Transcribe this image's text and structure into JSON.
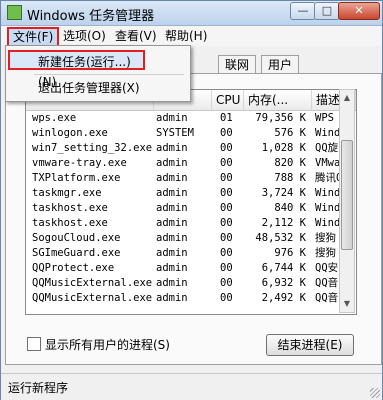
{
  "window": {
    "title": "Windows 任务管理器",
    "min": "—",
    "max": "□",
    "close": "✕"
  },
  "menu": {
    "file": "文件(F)",
    "options": "选项(O)",
    "view": "查看(V)",
    "help": "帮助(H)"
  },
  "file_menu": {
    "new_task": "新建任务(运行...)(N)",
    "exit": "退出任务管理器(X)"
  },
  "tabs": {
    "network": "联网",
    "users": "用户"
  },
  "table": {
    "headers": {
      "name": "",
      "user": "",
      "cpu": "CPU",
      "mem": "内存(...",
      "desc": "描述"
    },
    "rows": [
      {
        "name": "wps.exe",
        "user": "admin",
        "cpu": "01",
        "mem": "79,356 K",
        "desc": "WPS W"
      },
      {
        "name": "winlogon.exe",
        "user": "SYSTEM",
        "cpu": "00",
        "mem": "576 K",
        "desc": "Windo"
      },
      {
        "name": "win7_setting_32.exe",
        "user": "admin",
        "cpu": "00",
        "mem": "1,028 K",
        "desc": "QQ旋"
      },
      {
        "name": "vmware-tray.exe",
        "user": "admin",
        "cpu": "00",
        "mem": "820 K",
        "desc": "VMwa"
      },
      {
        "name": "TXPlatform.exe",
        "user": "admin",
        "cpu": "00",
        "mem": "788 K",
        "desc": "腾讯Q"
      },
      {
        "name": "taskmgr.exe",
        "user": "admin",
        "cpu": "00",
        "mem": "3,724 K",
        "desc": "Windo"
      },
      {
        "name": "taskhost.exe",
        "user": "admin",
        "cpu": "00",
        "mem": "840 K",
        "desc": "Windo"
      },
      {
        "name": "taskhost.exe",
        "user": "admin",
        "cpu": "00",
        "mem": "2,112 K",
        "desc": "Windo"
      },
      {
        "name": "SogouCloud.exe",
        "user": "admin",
        "cpu": "00",
        "mem": "48,532 K",
        "desc": "搜狗"
      },
      {
        "name": "SGImeGuard.exe",
        "user": "admin",
        "cpu": "00",
        "mem": "976 K",
        "desc": "搜狗"
      },
      {
        "name": "QQProtect.exe",
        "user": "admin",
        "cpu": "00",
        "mem": "6,744 K",
        "desc": "QQ安"
      },
      {
        "name": "QQMusicExternal.exe",
        "user": "admin",
        "cpu": "00",
        "mem": "6,932 K",
        "desc": "QQ音"
      },
      {
        "name": "QQMusicExternal.exe",
        "user": "admin",
        "cpu": "00",
        "mem": "2,492 K",
        "desc": "QQ音"
      }
    ]
  },
  "checkbox_label": "显示所有用户的进程(S)",
  "end_button": "结束进程(E)",
  "status": "运行新程序"
}
